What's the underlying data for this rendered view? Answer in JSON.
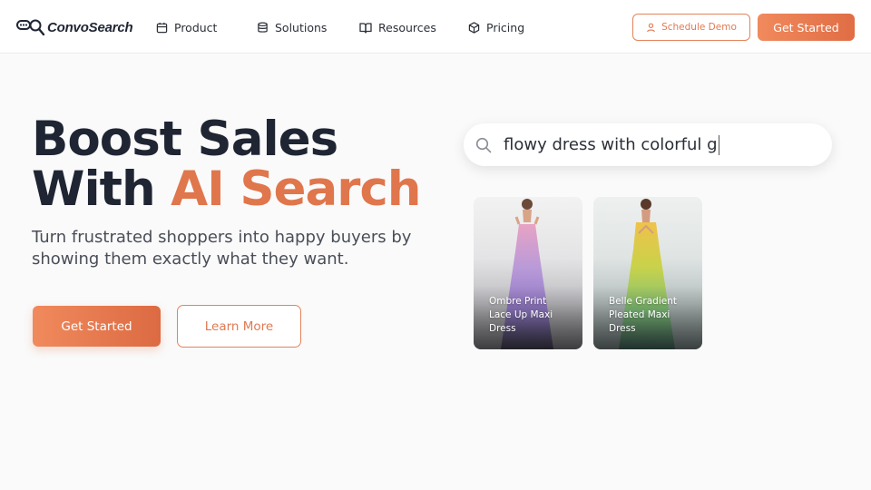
{
  "brand": {
    "name": "ConvoSearch"
  },
  "nav": {
    "items": [
      {
        "label": "Product",
        "icon": "calendar-icon"
      },
      {
        "label": "Solutions",
        "icon": "database-icon"
      },
      {
        "label": "Resources",
        "icon": "book-open-icon"
      },
      {
        "label": "Pricing",
        "icon": "box-icon"
      }
    ]
  },
  "header_actions": {
    "demo_label": "Schedule Demo",
    "start_label": "Get Started"
  },
  "hero": {
    "title_line1": "Boost Sales",
    "title_line2_prefix": "With ",
    "title_line2_accent": "AI Search",
    "subtitle": "Turn frustrated shoppers into happy buyers by showing them exactly what they want.",
    "primary_cta": "Get Started",
    "secondary_cta": "Learn More"
  },
  "search_demo": {
    "query": "flowy dress with colorful g",
    "results": [
      {
        "title": "Ombre Print Lace Up Maxi Dress"
      },
      {
        "title": "Belle Gradient Pleated Maxi Dress"
      }
    ]
  },
  "colors": {
    "accent": "#e0764c",
    "accent_gradient_start": "#f08a5d",
    "accent_gradient_end": "#dc6a42",
    "heading": "#1f2533",
    "background": "#fafafa"
  }
}
